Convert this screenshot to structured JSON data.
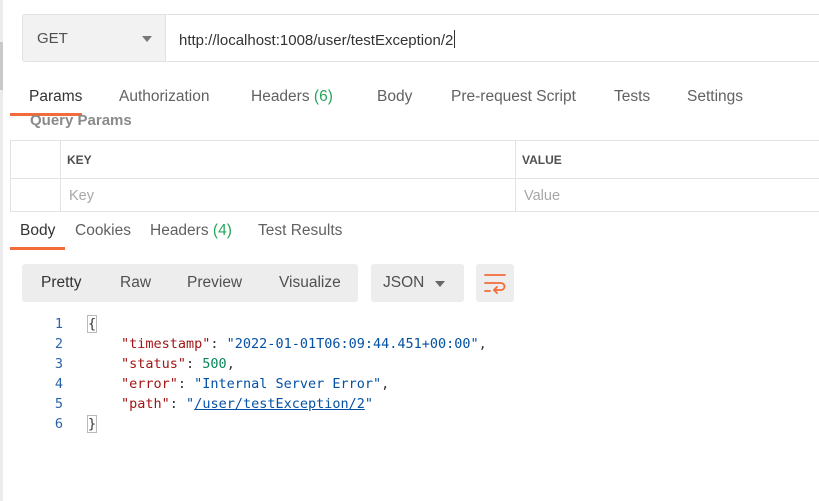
{
  "request": {
    "method": "GET",
    "url": "http://localhost:1008/user/testException/2"
  },
  "request_tabs": {
    "params": "Params",
    "authorization": "Authorization",
    "headers": "Headers",
    "headers_count": "(6)",
    "body": "Body",
    "prerequest": "Pre-request Script",
    "tests": "Tests",
    "settings": "Settings"
  },
  "query_params": {
    "title": "Query Params",
    "key_header": "KEY",
    "value_header": "VALUE",
    "key_placeholder": "Key",
    "value_placeholder": "Value"
  },
  "response_tabs": {
    "body": "Body",
    "cookies": "Cookies",
    "headers": "Headers",
    "headers_count": "(4)",
    "test_results": "Test Results"
  },
  "view": {
    "pretty": "Pretty",
    "raw": "Raw",
    "preview": "Preview",
    "visualize": "Visualize",
    "format": "JSON"
  },
  "response": {
    "line_numbers": [
      "1",
      "2",
      "3",
      "4",
      "5",
      "6"
    ],
    "open_brace": "{",
    "close_brace": "}",
    "timestamp_key": "\"timestamp\"",
    "timestamp_value": "\"2022-01-01T06:09:44.451+00:00\"",
    "status_key": "\"status\"",
    "status_value": "500",
    "error_key": "\"error\"",
    "error_value": "\"Internal Server Error\"",
    "path_key": "\"path\"",
    "path_value": "/user/testException/2"
  },
  "colors": {
    "accent": "#f26b3a",
    "count_green": "#26a65b"
  }
}
